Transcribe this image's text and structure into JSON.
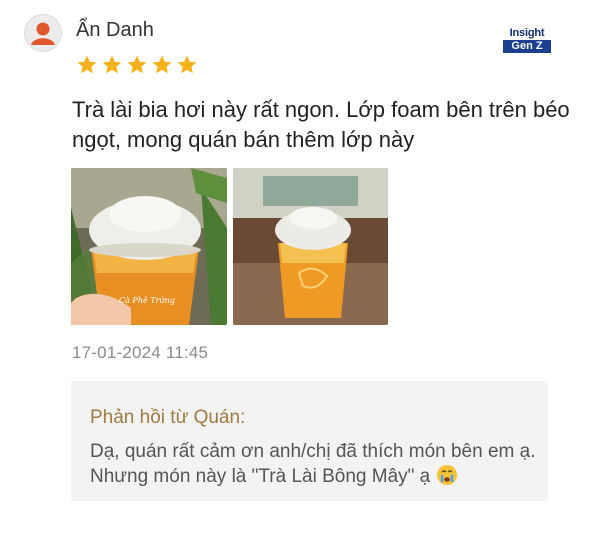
{
  "review": {
    "user_name": "Ẩn Danh",
    "rating": 5,
    "rating_max": 5,
    "text": "Trà lài bia hơi này rất ngon. Lớp foam bên trên béo ngọt, mong quán bán thêm lớp này",
    "timestamp": "17-01-2024 11:45",
    "photos": [
      "drink-photo-hand",
      "drink-photo-table"
    ],
    "cup_label": "Cà Phê Trứng"
  },
  "brand": {
    "line1": "Insight",
    "line2": "Gen Z"
  },
  "reply": {
    "title": "Phản hồi từ Quán:",
    "text": "Dạ, quán rất cảm ơn anh/chị đã thích món bên em ạ. Nhưng món này là \"Trà Lài Bông Mây\" ạ",
    "emoji": "crying-face-icon"
  },
  "colors": {
    "star": "#f6b21b",
    "avatar": "#e2562b",
    "reply_title": "#a07a42",
    "reply_bg": "#f3f3f3",
    "brand": "#1c3f8f"
  }
}
